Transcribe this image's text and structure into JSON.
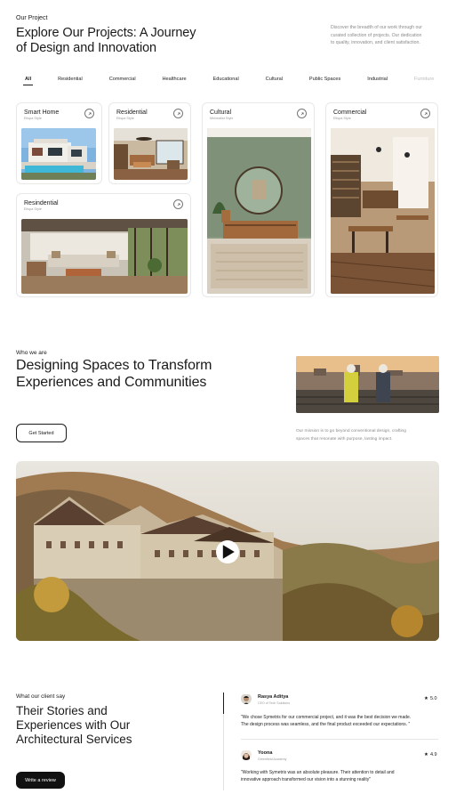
{
  "projects": {
    "eyebrow": "Our Project",
    "title_line1": "Explore Our Projects: A Journey",
    "title_line2": "of Design and Innovation",
    "description_line1": "Discover the breadth of our work through our",
    "description_line2": "curated collection of projects. Our dedication",
    "description_line3": "to quality, innovation, and client satisfaction."
  },
  "filters": [
    {
      "label": "All",
      "active": true
    },
    {
      "label": "Residential"
    },
    {
      "label": "Commercial"
    },
    {
      "label": "Healthcare"
    },
    {
      "label": "Educational"
    },
    {
      "label": "Cultural"
    },
    {
      "label": "Public Spaces"
    },
    {
      "label": "Industrial"
    },
    {
      "label": "Furniture"
    }
  ],
  "cards": [
    {
      "title": "Smart Home",
      "subtitle": "Elispa Style",
      "icon": "arrow-up-right-icon"
    },
    {
      "title": "Residential",
      "subtitle": "Elispa Style",
      "icon": "arrow-up-right-icon"
    },
    {
      "title": "Cultural",
      "subtitle": "Minimalist Style",
      "icon": "arrow-up-right-icon"
    },
    {
      "title": "Commercial",
      "subtitle": "Elispa Style",
      "icon": "arrow-up-right-icon"
    },
    {
      "title": "Resindential",
      "subtitle": "Elispa Style",
      "icon": "arrow-up-right-icon"
    }
  ],
  "about": {
    "eyebrow": "Who we are",
    "title_line1": "Designing Spaces to Transform",
    "title_line2": "Experiences and Communities",
    "cta": "Get Started",
    "mission_line1": "Our mission is to go beyond conventional design, crafting",
    "mission_line2": "spaces that resonate with purpose, lasting impact."
  },
  "video": {
    "play_icon": "play-icon"
  },
  "testimonials": {
    "eyebrow": "What our client say",
    "title_line1": "Their Stories and",
    "title_line2": "Experiences with Our",
    "title_line3": "Architectural Services",
    "cta": "Write a review",
    "reviews": [
      {
        "name": "Rasya Aditya",
        "role": "CEO of Tech Solutions",
        "rating": "5.0",
        "quote_line1": "\"We chose Symetris for our commercial project, and it was the best decision we made.",
        "quote_line2": "The design process was seamless, and the final product exceeded our expectations. \""
      },
      {
        "name": "Yoona",
        "role": "Greenfield Academy",
        "rating": "4.9",
        "quote_line1": "\"Working with Symetris was an absolute pleasure. Their attention to detail and",
        "quote_line2": "innovative approach transformed our vision into a stunning reality\""
      }
    ],
    "star_icon": "star-icon"
  },
  "colors": {
    "text": "#1a1a1a",
    "muted": "#8a8a8a",
    "border": "#e8e8e8",
    "button_dark": "#111111"
  }
}
